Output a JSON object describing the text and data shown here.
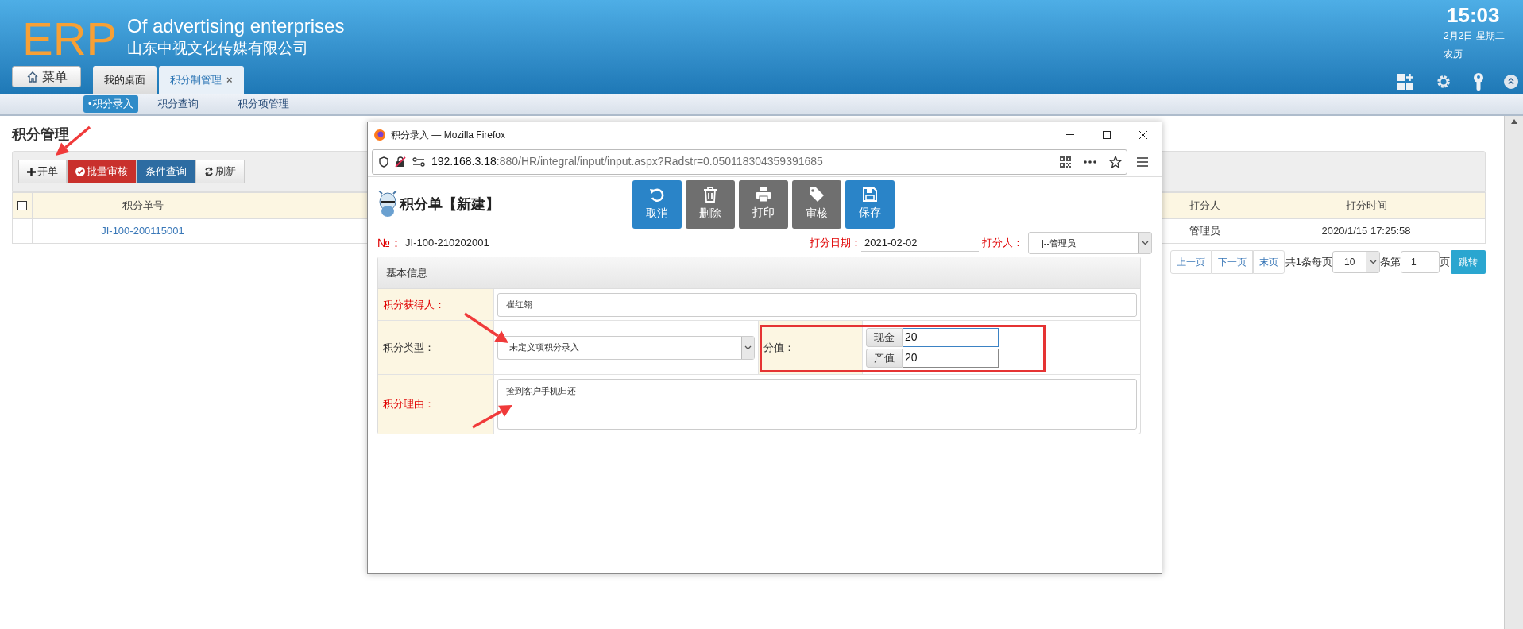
{
  "header": {
    "logo": "ERP",
    "slogan": "Of advertising enterprises",
    "company": "山东中视文化传媒有限公司",
    "menu_button": "菜单",
    "tabs": [
      {
        "label": "我的桌面",
        "selected": false
      },
      {
        "label": "积分制管理",
        "selected": true,
        "close": "×"
      }
    ],
    "clock": {
      "time": "15:03",
      "date": "2月2日 星期二",
      "lunar": "农历"
    }
  },
  "subnav": [
    {
      "label": "•积分录入",
      "selected": true
    },
    {
      "label": "积分查询",
      "selected": false
    },
    {
      "label": "积分项管理",
      "selected": false
    }
  ],
  "page": {
    "title": "积分管理",
    "toolbar": [
      {
        "label": "开单",
        "kind": "add"
      },
      {
        "label": "批量审核",
        "kind": "approve"
      },
      {
        "label": "条件查询",
        "kind": "query"
      },
      {
        "label": "刷新",
        "kind": "refresh"
      }
    ],
    "table": {
      "select_all_checked": false,
      "columns": [
        "积分单号",
        "打分人",
        "打分时间"
      ],
      "rows": [
        {
          "cells": [
            "JI-100-200115001",
            "管理员",
            "2020/1/15 17:25:58"
          ]
        }
      ]
    },
    "pagination": {
      "prev": "上一页",
      "next": "下一页",
      "last": "末页",
      "total": "共1条每页",
      "page_size": "10",
      "per": "条第",
      "page": "1",
      "page_suffix": "页",
      "go": "跳转"
    }
  },
  "dialog": {
    "title": "积分录入 — Mozilla Firefox",
    "url_host": "192.168.3.18",
    "url_path": ":880/HR/integral/input/input.aspx?Radstr=0.050118304359391685",
    "form_title": "积分单【新建】",
    "actions": [
      {
        "label": "取消",
        "kind": "undo",
        "color": "#2a84c8"
      },
      {
        "label": "删除",
        "kind": "delete",
        "color": "#6f6f6f"
      },
      {
        "label": "打印",
        "kind": "print",
        "color": "#6f6f6f"
      },
      {
        "label": "审核",
        "kind": "tag",
        "color": "#6f6f6f"
      },
      {
        "label": "保存",
        "kind": "save",
        "color": "#2a84c8"
      }
    ],
    "number_label": "№：",
    "number": "JI-100-210202001",
    "date_label": "打分日期：",
    "date": "2021-02-02",
    "scorer_label": "打分人：",
    "scorer": "|--管理员",
    "section": "基本信息",
    "recipient": {
      "label": "积分获得人：",
      "required": true,
      "value": "崔红翎"
    },
    "type": {
      "label": "积分类型：",
      "required": false,
      "value": "未定义项积分录入"
    },
    "score": {
      "label": "分值：",
      "required": false,
      "items": [
        {
          "label": "现金",
          "value": "20",
          "focused": true
        },
        {
          "label": "产值",
          "value": "20",
          "focused": false
        }
      ]
    },
    "reason": {
      "label": "积分理由：",
      "required": true,
      "value": "捡到客户手机归还"
    }
  }
}
